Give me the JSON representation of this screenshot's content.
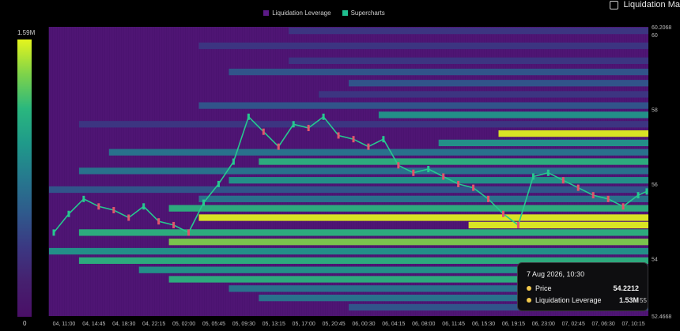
{
  "legend": {
    "items": [
      {
        "label": "Liquidation Leverage",
        "color": "#5b1a86"
      },
      {
        "label": "Supercharts",
        "color": "#1fbf8f"
      }
    ]
  },
  "toggle": {
    "label": "Liquidation Ma",
    "checked": false
  },
  "colorbar": {
    "max_label": "1.59M",
    "min_label": "0",
    "colors": [
      "#e5f51d",
      "#7ed34a",
      "#2ab77e",
      "#1f9a8a",
      "#26798e",
      "#2f5a8c",
      "#3b3882",
      "#46206f",
      "#4a0f67"
    ]
  },
  "tooltip": {
    "title": "7 Aug 2026, 10:30",
    "rows": [
      {
        "label": "Price",
        "value": "54.2212"
      },
      {
        "label": "Liquidation Leverage",
        "value": "1.53M"
      }
    ],
    "tail": "55"
  },
  "chart_data": {
    "type": "heatmap",
    "title": "",
    "xlabel": "",
    "ylabel": "",
    "x_ticks": [
      "04, 11:00",
      "04, 14:45",
      "04, 18:30",
      "04, 22:15",
      "05, 02:00",
      "05, 05:45",
      "05, 09:30",
      "05, 13:15",
      "05, 17:00",
      "05, 20:45",
      "06, 00:30",
      "06, 04:15",
      "06, 08:00",
      "06, 11:45",
      "06, 15:30",
      "06, 19:15",
      "06, 23:00",
      "07, 02:45",
      "07, 06:30",
      "07, 10:15"
    ],
    "y_ticks": [
      60,
      58,
      56,
      54
    ],
    "y_max_label": "60.2068",
    "y_min_label": "52.4668",
    "ylim": [
      52.4668,
      60.2068
    ],
    "color_scale": {
      "min": 0,
      "max": 1590000,
      "min_label": "0",
      "max_label": "1.59M"
    },
    "price_series": {
      "name": "Supercharts",
      "x_index": [
        0,
        1,
        2,
        3,
        4,
        5,
        6,
        7,
        8,
        9,
        10,
        11,
        12,
        13,
        14,
        15,
        16,
        17,
        18,
        19,
        20,
        21,
        22,
        23,
        24,
        25,
        26,
        27,
        28,
        29,
        30,
        31,
        32,
        33,
        34,
        35,
        36,
        37,
        38,
        39,
        40
      ],
      "x": [
        "04, 11:00",
        "04, 12:52",
        "04, 14:45",
        "04, 16:37",
        "04, 18:30",
        "04, 20:22",
        "04, 22:15",
        "05, 00:07",
        "05, 02:00",
        "05, 03:52",
        "05, 05:45",
        "05, 07:37",
        "05, 09:30",
        "05, 11:22",
        "05, 13:15",
        "05, 15:07",
        "05, 17:00",
        "05, 18:52",
        "05, 20:45",
        "05, 22:37",
        "06, 00:30",
        "06, 02:22",
        "06, 04:15",
        "06, 06:07",
        "06, 08:00",
        "06, 09:52",
        "06, 11:45",
        "06, 13:37",
        "06, 15:30",
        "06, 17:22",
        "06, 19:15",
        "06, 21:07",
        "06, 23:00",
        "07, 00:52",
        "07, 02:45",
        "07, 04:37",
        "07, 06:30",
        "07, 08:22",
        "07, 10:15",
        "07, 11:15",
        "07, 12:15"
      ],
      "y": [
        54.7,
        55.2,
        55.6,
        55.4,
        55.3,
        55.1,
        55.4,
        55.0,
        54.9,
        54.7,
        55.5,
        56.0,
        56.6,
        57.8,
        57.4,
        57.0,
        57.6,
        57.5,
        57.8,
        57.3,
        57.2,
        57.0,
        57.2,
        56.5,
        56.3,
        56.4,
        56.2,
        56.0,
        55.9,
        55.6,
        55.2,
        54.9,
        56.2,
        56.3,
        56.1,
        55.9,
        55.7,
        55.6,
        55.4,
        55.7,
        55.8
      ]
    },
    "heat_bands": [
      {
        "y": 60.1,
        "x_start": "05, 17:00",
        "x_end": "07, 12:15",
        "value": 420000
      },
      {
        "y": 59.7,
        "x_start": "05, 05:45",
        "x_end": "07, 12:15",
        "value": 380000
      },
      {
        "y": 59.3,
        "x_start": "05, 17:00",
        "x_end": "07, 12:15",
        "value": 300000
      },
      {
        "y": 59.0,
        "x_start": "05, 09:30",
        "x_end": "07, 12:15",
        "value": 620000
      },
      {
        "y": 58.7,
        "x_start": "06, 00:30",
        "x_end": "07, 12:15",
        "value": 560000
      },
      {
        "y": 58.4,
        "x_start": "05, 20:45",
        "x_end": "07, 12:15",
        "value": 460000
      },
      {
        "y": 58.1,
        "x_start": "05, 05:45",
        "x_end": "07, 12:15",
        "value": 520000
      },
      {
        "y": 57.85,
        "x_start": "06, 04:15",
        "x_end": "07, 12:15",
        "value": 980000
      },
      {
        "y": 57.6,
        "x_start": "04, 14:45",
        "x_end": "07, 12:15",
        "value": 380000
      },
      {
        "y": 57.35,
        "x_start": "06, 19:15",
        "x_end": "07, 12:15",
        "value": 1530000
      },
      {
        "y": 57.1,
        "x_start": "06, 11:45",
        "x_end": "07, 12:15",
        "value": 900000
      },
      {
        "y": 56.85,
        "x_start": "04, 18:30",
        "x_end": "07, 12:15",
        "value": 700000
      },
      {
        "y": 56.6,
        "x_start": "05, 13:15",
        "x_end": "07, 12:15",
        "value": 1220000
      },
      {
        "y": 56.35,
        "x_start": "04, 14:45",
        "x_end": "07, 12:15",
        "value": 820000
      },
      {
        "y": 56.1,
        "x_start": "05, 09:30",
        "x_end": "07, 12:15",
        "value": 960000
      },
      {
        "y": 55.85,
        "x_start": "04, 11:00",
        "x_end": "07, 12:15",
        "value": 500000
      },
      {
        "y": 55.6,
        "x_start": "05, 05:45",
        "x_end": "07, 12:15",
        "value": 880000
      },
      {
        "y": 55.35,
        "x_start": "05, 02:00",
        "x_end": "07, 12:15",
        "value": 1120000
      },
      {
        "y": 55.1,
        "x_start": "05, 05:45",
        "x_end": "07, 12:15",
        "value": 1580000
      },
      {
        "y": 54.9,
        "x_start": "06, 15:30",
        "x_end": "07, 12:15",
        "value": 1500000
      },
      {
        "y": 54.7,
        "x_start": "04, 14:45",
        "x_end": "07, 12:15",
        "value": 1180000
      },
      {
        "y": 54.45,
        "x_start": "05, 02:00",
        "x_end": "07, 12:15",
        "value": 1480000
      },
      {
        "y": 54.2,
        "x_start": "04, 11:00",
        "x_end": "07, 12:15",
        "value": 1040000
      },
      {
        "y": 53.95,
        "x_start": "04, 14:45",
        "x_end": "07, 12:15",
        "value": 1260000
      },
      {
        "y": 53.7,
        "x_start": "04, 22:15",
        "x_end": "07, 12:15",
        "value": 980000
      },
      {
        "y": 53.45,
        "x_start": "05, 02:00",
        "x_end": "07, 12:15",
        "value": 1100000
      },
      {
        "y": 53.2,
        "x_start": "05, 09:30",
        "x_end": "07, 12:15",
        "value": 860000
      },
      {
        "y": 52.95,
        "x_start": "05, 13:15",
        "x_end": "07, 12:15",
        "value": 700000
      },
      {
        "y": 52.7,
        "x_start": "06, 00:30",
        "x_end": "07, 12:15",
        "value": 540000
      }
    ]
  }
}
